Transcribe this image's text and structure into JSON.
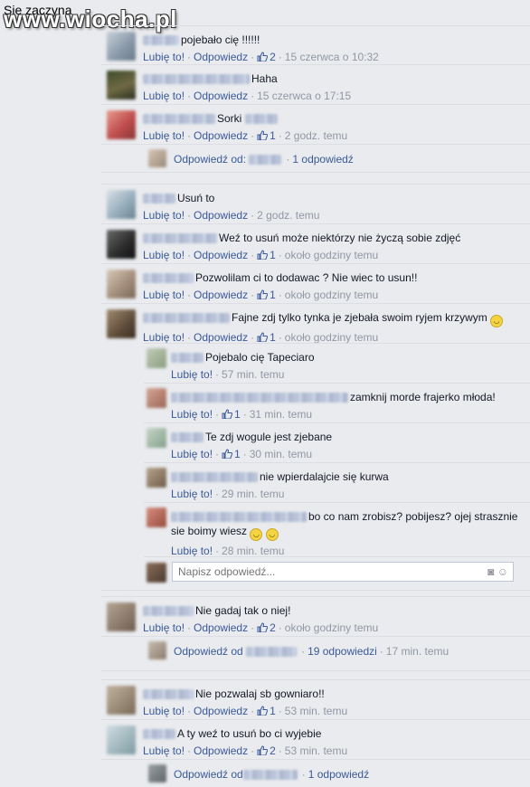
{
  "caption": "Sie zaczyna",
  "watermark": "www.wiocha.pl",
  "ui": {
    "like": "Lubię to!",
    "reply": "Odpowiedz",
    "reply_to_prefix": "Odpowiedź od:",
    "reply_to_prefix2": "Odpowiedź od",
    "write_placeholder": "Napisz odpowiedź..."
  },
  "comments": [
    {
      "text": "pojebało cię !!!!!!",
      "likes": "2",
      "time": "15 czerwca o 10:32",
      "avatar_color": "#9aa8b8"
    },
    {
      "text": "Haha",
      "likes": "",
      "time": "15 czerwca o 17:15",
      "avatar_color": "#5a5d3c"
    },
    {
      "text": "Sorki",
      "likes": "1",
      "time": "2 godz. temu",
      "avatar_color": "#c96a6a"
    },
    {
      "summary": "1 odpowiedź"
    },
    {
      "text": "Usuń to",
      "likes": "",
      "time": "2 godz. temu",
      "avatar_color": "#9fb3c2"
    },
    {
      "text": "Weź to usuń może niektórzy nie życzą sobie zdjęć",
      "likes": "1",
      "time": "około godziny temu",
      "avatar_color": "#3c3c3c"
    },
    {
      "text": "Pozwolilam ci to dodawac ? Nie wiec to usun!!",
      "likes": "1",
      "time": "około godziny temu",
      "avatar_color": "#b7a493"
    },
    {
      "text": "Fajne zdj tylko tynka je zjebała swoim ryjem krzywym",
      "likes": "1",
      "time": "około godziny temu",
      "avatar_color": "#6b5a48"
    }
  ],
  "replies": [
    {
      "text": "Pojebalo cię Tapeciaro",
      "likes": "",
      "time": "57 min. temu",
      "avatar_color": "#a7b59a"
    },
    {
      "text": "zamknij morde frajerko młoda!",
      "likes": "1",
      "time": "31 min. temu",
      "avatar_color": "#b0806e"
    },
    {
      "text": "Te zdj wogule jest zjebane",
      "likes": "1",
      "time": "30 min. temu",
      "avatar_color": "#9bb3a0"
    },
    {
      "text": "nie wpierdalajcie się kurwa",
      "likes": "",
      "time": "29 min. temu",
      "avatar_color": "#8d7a64"
    },
    {
      "text": "bo co nam zrobisz? pobijesz? ojej strasznie sie boimy wiesz",
      "likes": "",
      "time": "28 min. temu",
      "avatar_color": "#b46b5c"
    }
  ],
  "after": [
    {
      "text": "Nie gadaj tak o niej!",
      "likes": "2",
      "time": "około godziny temu",
      "avatar_color": "#8c7a6a"
    },
    {
      "summary": "19 odpowiedzi",
      "time": "17 min. temu"
    },
    {
      "text": "Nie pozwalaj sb gowniaro!!",
      "likes": "1",
      "time": "53 min. temu",
      "avatar_color": "#9a8a78"
    },
    {
      "text": "A ty weź to usuń bo ci wyjebie",
      "likes": "2",
      "time": "53 min. temu",
      "avatar_color": "#9bb2b8"
    },
    {
      "summary": "1 odpowiedź"
    }
  ]
}
